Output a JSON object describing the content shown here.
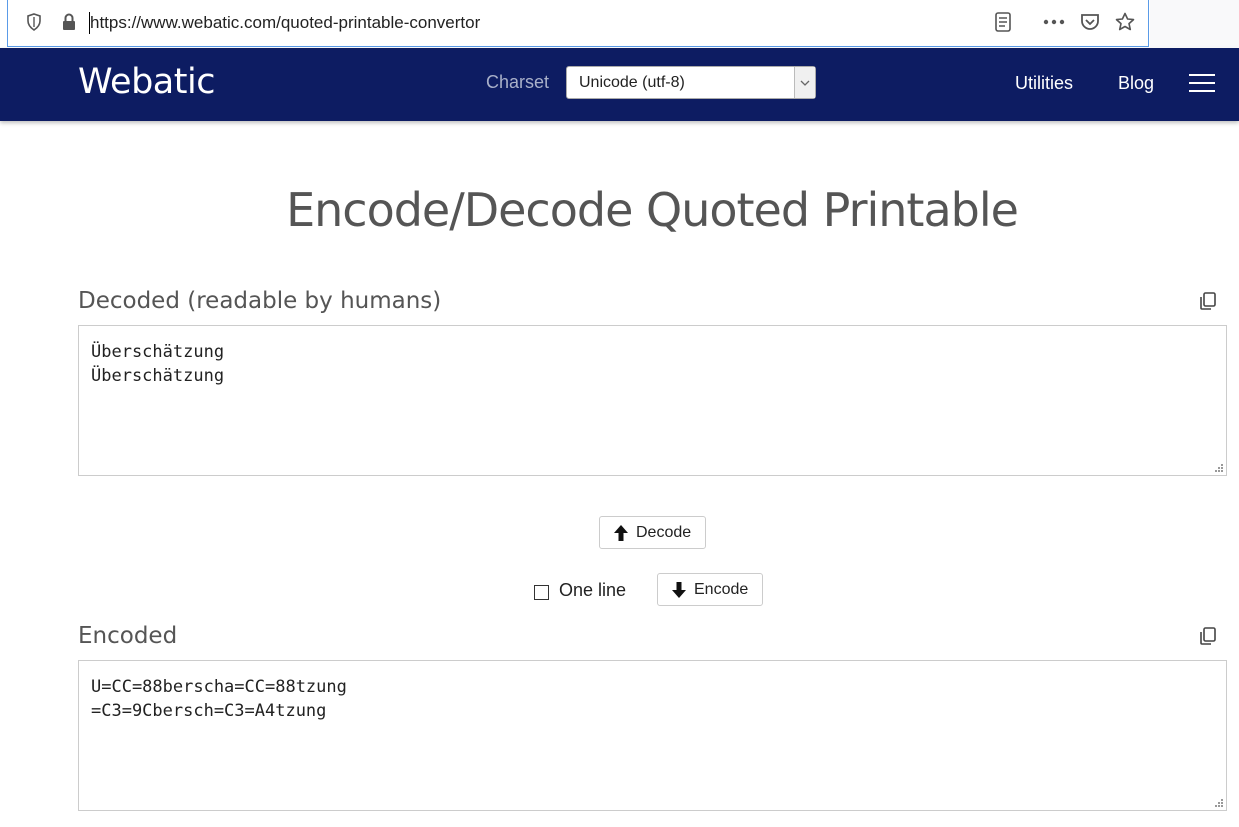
{
  "browser": {
    "url": "https://www.webatic.com/quoted-printable-convertor",
    "icons": [
      "shield-icon",
      "lock-icon",
      "reader-view-icon",
      "more-icon",
      "pocket-icon",
      "bookmark-star-icon"
    ]
  },
  "nav": {
    "brand": "Webatic",
    "charset_label": "Charset",
    "charset_value": "Unicode (utf-8)",
    "links": [
      "Utilities",
      "Blog"
    ],
    "background": "#0d1c62"
  },
  "main": {
    "title": "Encode/Decode Quoted Printable",
    "decoded": {
      "label": "Decoded (readable by humans)",
      "value": "Überschätzung\nÜberschätzung"
    },
    "decode_button": "Decode",
    "one_line_label": "One line",
    "one_line_checked": false,
    "encode_button": "Encode",
    "encoded": {
      "label": "Encoded",
      "value": "U=CC=88berscha=CC=88tzung\n=C3=9Cbersch=C3=A4tzung"
    }
  }
}
